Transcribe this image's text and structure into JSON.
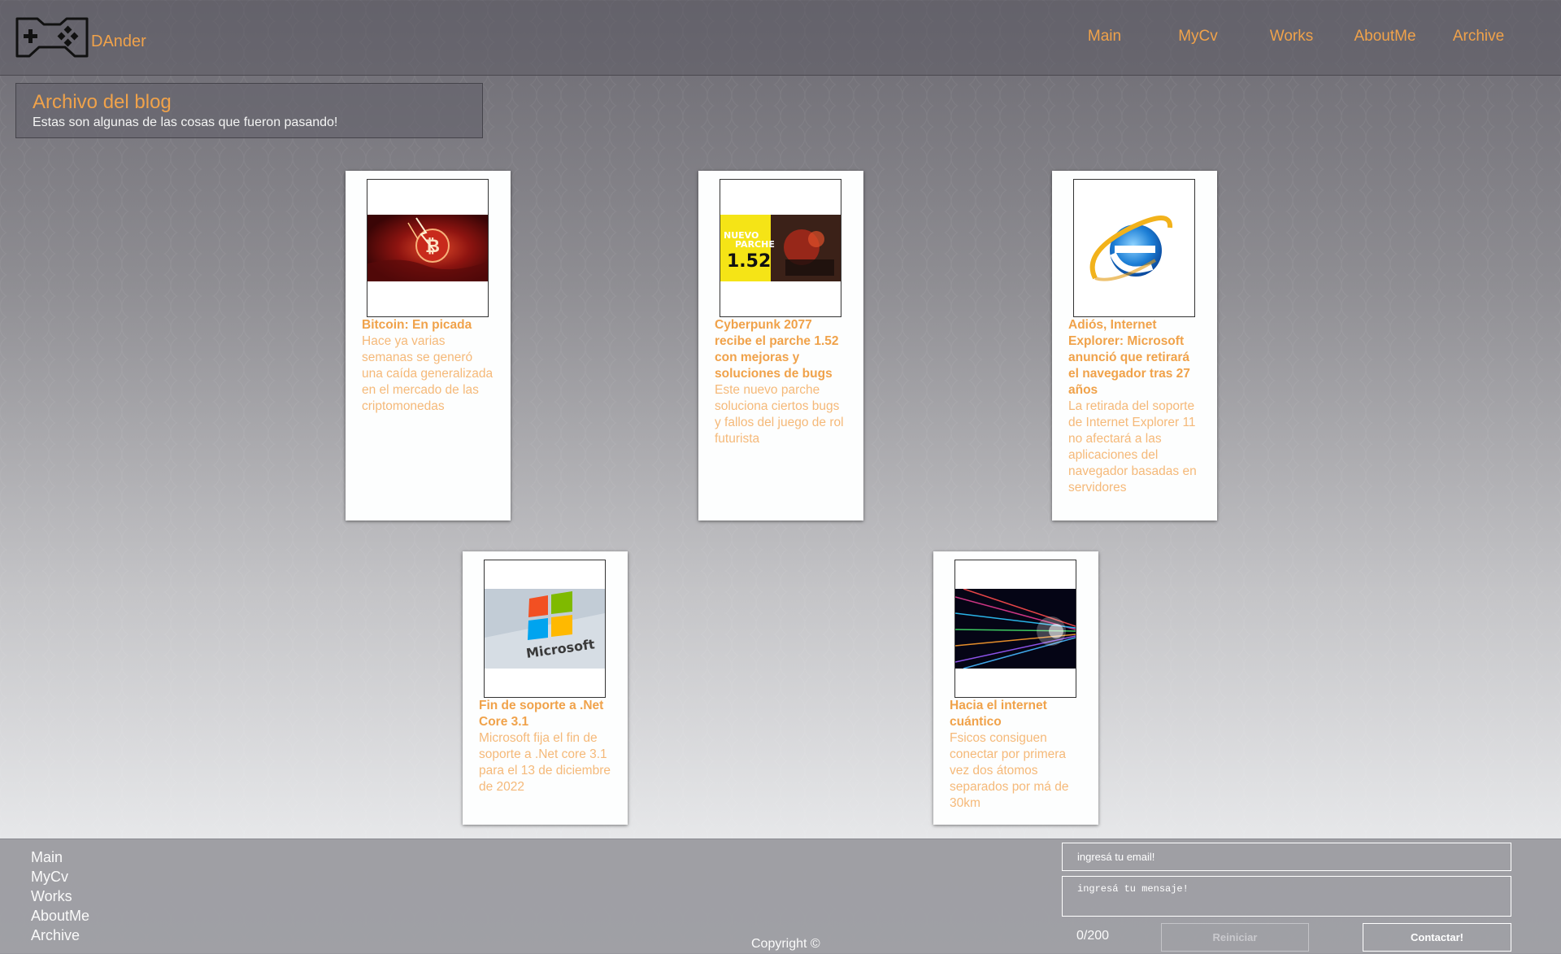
{
  "header": {
    "brand": "DAnder",
    "logo_icon": "gamepad-icon",
    "nav": [
      "Main",
      "MyCv",
      "Works",
      "AboutMe",
      "Archive"
    ]
  },
  "intro": {
    "title": "Archivo del blog",
    "subtitle": "Estas son algunas de las cosas que fueron pasando!"
  },
  "posts": [
    {
      "title": "Bitcoin: En picada",
      "description": "Hace ya varias semanas se generó una caída generalizada en el mercado de las criptomonedas",
      "image": "bitcoin-crash-image"
    },
    {
      "title": "Cyberpunk 2077 recibe el parche 1.52 con mejoras y soluciones de bugs",
      "description": "Este nuevo parche soluciona ciertos bugs y fallos del juego de rol futurista",
      "image": "cyberpunk-patch-image",
      "image_text": [
        "NUEVO",
        "PARCHE",
        "1.52"
      ]
    },
    {
      "title": "Adiós, Internet Explorer: Microsoft anunció que retirará el navegador tras 27 años",
      "description": "La retirada del soporte de Internet Explorer 11 no afectará a las aplicaciones del navegador basadas en servidores",
      "image": "internet-explorer-logo-image"
    },
    {
      "title": "Fin de soporte a .Net Core 3.1",
      "description": "Microsoft fija el fin de soporte a .Net core 3.1 para el 13 de diciembre de 2022",
      "image": "microsoft-logo-image",
      "image_text": [
        "Microsoft"
      ]
    },
    {
      "title": "Hacia el internet cuántico",
      "description": "Fsicos consiguen conectar por primera vez dos átomos separados por má de 30km",
      "image": "fiber-optics-image"
    }
  ],
  "footer": {
    "links": [
      "Main",
      "MyCv",
      "Works",
      "AboutMe",
      "Archive"
    ],
    "copyright": "Copyright ©",
    "email_placeholder": "ingresá tu email!",
    "message_placeholder": "ingresá tu mensaje!",
    "counter": "0/200",
    "reset_label": "Reiniciar",
    "submit_label": "Contactar!"
  },
  "colors": {
    "accent": "#f0a24a",
    "accent_light": "#f5b979"
  }
}
